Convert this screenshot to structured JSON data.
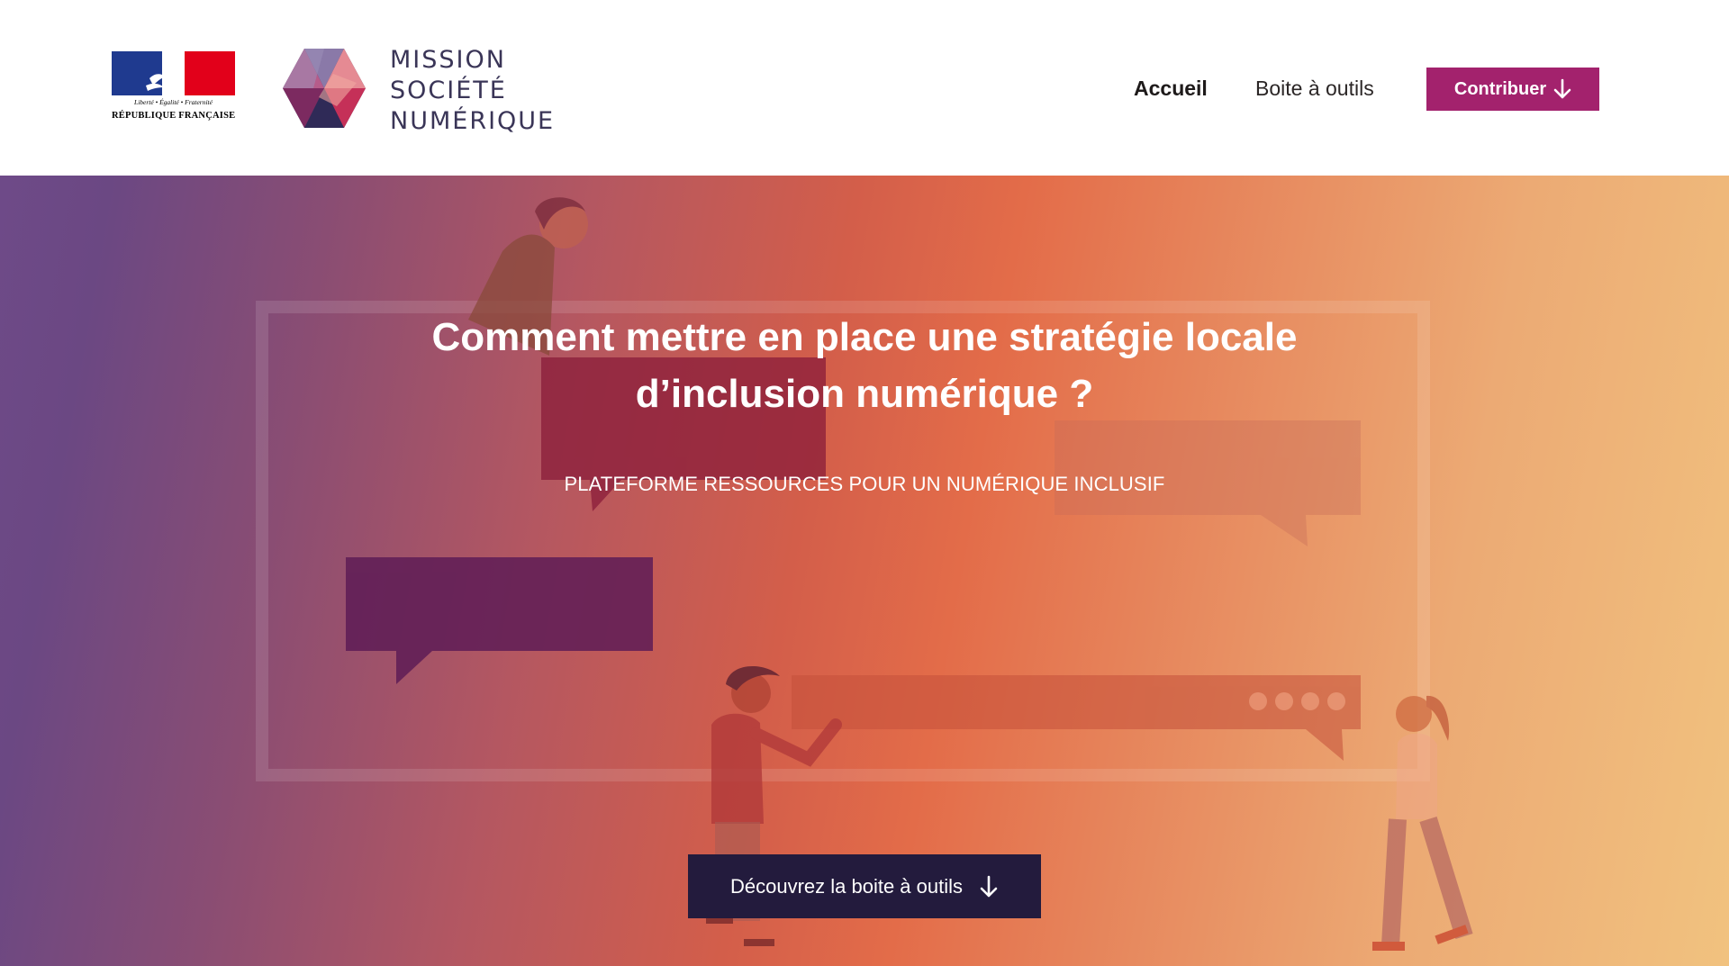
{
  "header": {
    "gov_logo": {
      "motto": "Liberté • Égalité • Fraternité",
      "name": "RÉPUBLIQUE FRANÇAISE",
      "colors": {
        "blue": "#1f3a8f",
        "red": "#e2001a"
      }
    },
    "brand_logo": {
      "lines": [
        "MISSION",
        "SOCIÉTÉ",
        "NUMÉRIQUE"
      ],
      "icon": "hexagon-logo-icon"
    },
    "nav": {
      "home_label": "Accueil",
      "tools_label": "Boite à outils",
      "contribute_label": "Contribuer",
      "contribute_icon": "arrow-down-icon",
      "contribute_color": "#a3226d"
    }
  },
  "hero": {
    "title_line1": "Comment mettre en place une stratégie locale",
    "title_line2": "d’inclusion numérique ?",
    "subtitle": "PLATEFORME RESSOURCES POUR UN NUMÉRIQUE INCLUSIF",
    "cta_label": "Découvrez la boite à outils",
    "cta_icon": "arrow-down-icon",
    "cta_color": "#231b3d"
  }
}
